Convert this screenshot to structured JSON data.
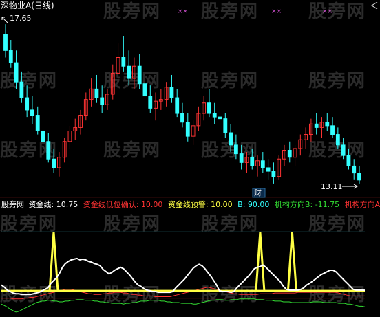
{
  "main_panel": {
    "title": "深物业A(日线)",
    "high_label": "17.65",
    "low_label": "13.11",
    "marker_label": "财"
  },
  "indicator_panel": {
    "brand": "股旁网",
    "items": [
      {
        "label": "资金线:",
        "value": "10.75",
        "color": "#ffffff"
      },
      {
        "label": "资金线低位确认:",
        "value": "10.00",
        "color": "#ff3333"
      },
      {
        "label": "资金线预警:",
        "value": "10.00",
        "color": "#ffff44"
      },
      {
        "label": "B:",
        "value": "90.00",
        "color": "#33ffff"
      },
      {
        "label": "机构方向B:",
        "value": "-11.75",
        "color": "#33dd33"
      },
      {
        "label": "机构方向A:",
        "value": "",
        "color": "#ff3333"
      }
    ]
  },
  "watermark": "股旁网",
  "colors": {
    "up": "#ff3333",
    "down": "#33ffff",
    "line_cyan": "#40c0d0",
    "line_yellow": "#ffff44",
    "line_red": "#ff3333",
    "line_green": "#33dd33",
    "line_white": "#ffffff"
  },
  "chart_data": [
    {
      "type": "candlestick",
      "title": "深物业A(日线)",
      "annotations": [
        "17.65",
        "13.11",
        "财"
      ],
      "ohlc": [
        [
          17.35,
          17.65,
          16.7,
          16.9
        ],
        [
          16.9,
          17.2,
          16.4,
          16.55
        ],
        [
          16.55,
          16.9,
          15.8,
          16.0
        ],
        [
          16.0,
          16.3,
          15.4,
          15.55
        ],
        [
          15.55,
          15.9,
          15.0,
          15.2
        ],
        [
          15.2,
          15.6,
          14.8,
          15.05
        ],
        [
          15.05,
          15.3,
          14.5,
          14.6
        ],
        [
          14.6,
          15.0,
          14.1,
          14.3
        ],
        [
          14.3,
          14.55,
          13.7,
          13.8
        ],
        [
          13.8,
          14.1,
          13.4,
          13.55
        ],
        [
          13.55,
          14.0,
          13.3,
          13.85
        ],
        [
          13.85,
          14.4,
          13.7,
          14.3
        ],
        [
          14.3,
          14.75,
          14.1,
          14.6
        ],
        [
          14.6,
          14.95,
          14.35,
          14.7
        ],
        [
          14.7,
          15.2,
          14.5,
          15.05
        ],
        [
          15.05,
          15.7,
          14.9,
          15.5
        ],
        [
          15.5,
          16.1,
          15.3,
          15.8
        ],
        [
          15.8,
          16.2,
          15.4,
          15.55
        ],
        [
          15.55,
          15.9,
          15.1,
          15.35
        ],
        [
          15.35,
          15.8,
          15.2,
          15.65
        ],
        [
          15.65,
          16.5,
          15.5,
          16.25
        ],
        [
          16.25,
          17.1,
          16.0,
          16.7
        ],
        [
          16.7,
          17.3,
          16.3,
          16.45
        ],
        [
          16.45,
          16.9,
          15.9,
          16.1
        ],
        [
          16.1,
          16.7,
          15.8,
          16.45
        ],
        [
          16.45,
          16.8,
          15.8,
          15.95
        ],
        [
          15.95,
          16.3,
          15.4,
          15.6
        ],
        [
          15.6,
          15.9,
          15.1,
          15.25
        ],
        [
          15.25,
          15.7,
          14.9,
          15.45
        ],
        [
          15.45,
          15.8,
          15.2,
          15.5
        ],
        [
          15.5,
          16.0,
          15.3,
          15.85
        ],
        [
          15.85,
          16.2,
          15.4,
          15.55
        ],
        [
          15.55,
          15.8,
          15.0,
          15.1
        ],
        [
          15.1,
          15.4,
          14.7,
          14.85
        ],
        [
          14.85,
          15.1,
          14.3,
          14.45
        ],
        [
          14.45,
          14.9,
          14.2,
          14.75
        ],
        [
          14.75,
          15.3,
          14.6,
          15.1
        ],
        [
          15.1,
          15.6,
          14.9,
          15.4
        ],
        [
          15.4,
          15.8,
          15.0,
          15.1
        ],
        [
          15.1,
          15.4,
          14.8,
          15.0
        ],
        [
          15.0,
          15.3,
          14.7,
          14.95
        ],
        [
          14.95,
          15.1,
          14.4,
          14.55
        ],
        [
          14.55,
          14.8,
          14.0,
          14.2
        ],
        [
          14.2,
          14.5,
          13.8,
          13.95
        ],
        [
          13.95,
          14.2,
          13.5,
          13.7
        ],
        [
          13.7,
          14.0,
          13.4,
          13.85
        ],
        [
          13.85,
          14.1,
          13.5,
          13.6
        ],
        [
          13.6,
          13.9,
          13.3,
          13.75
        ],
        [
          13.75,
          14.0,
          13.4,
          13.55
        ],
        [
          13.55,
          13.8,
          13.2,
          13.45
        ],
        [
          13.45,
          13.7,
          13.1,
          13.3
        ],
        [
          13.3,
          13.9,
          13.2,
          13.8
        ],
        [
          13.8,
          14.2,
          13.6,
          14.05
        ],
        [
          14.05,
          14.3,
          13.7,
          13.85
        ],
        [
          13.85,
          14.2,
          13.6,
          14.1
        ],
        [
          14.1,
          14.5,
          13.9,
          14.35
        ],
        [
          14.35,
          14.7,
          14.1,
          14.5
        ],
        [
          14.5,
          14.95,
          14.3,
          14.8
        ],
        [
          14.8,
          15.1,
          14.5,
          14.7
        ],
        [
          14.7,
          15.0,
          14.4,
          14.85
        ],
        [
          14.85,
          15.1,
          14.6,
          14.75
        ],
        [
          14.75,
          15.0,
          14.4,
          14.5
        ],
        [
          14.5,
          14.7,
          14.1,
          14.2
        ],
        [
          14.2,
          14.4,
          13.8,
          13.9
        ],
        [
          13.9,
          14.1,
          13.5,
          13.6
        ],
        [
          13.6,
          13.8,
          13.2,
          13.4
        ],
        [
          13.4,
          13.6,
          13.1,
          13.2
        ]
      ]
    },
    {
      "type": "line",
      "title": "股旁网",
      "ylim": [
        -20,
        110
      ],
      "series": [
        {
          "name": "资金线",
          "values": [
            18,
            15,
            11,
            9,
            7,
            6,
            6,
            5,
            5,
            5,
            5,
            6,
            7,
            8,
            10,
            12,
            14,
            20,
            24,
            28,
            34,
            42,
            47,
            50,
            52,
            53,
            54,
            52,
            53,
            52,
            50,
            49,
            47,
            46,
            44,
            39,
            36,
            33,
            35,
            38,
            40,
            42,
            40,
            36,
            32,
            27,
            22,
            18,
            16,
            13,
            11,
            10,
            9,
            9,
            8,
            8,
            8,
            8,
            8,
            9,
            14,
            18,
            22,
            26,
            31,
            36,
            41,
            44,
            46,
            44,
            40,
            35,
            30,
            24,
            18,
            10,
            9,
            9,
            9,
            8,
            9,
            14,
            18,
            22,
            26,
            30,
            35,
            40,
            42,
            43,
            45,
            42,
            38,
            34,
            30,
            26,
            22,
            16,
            12,
            11,
            11,
            11,
            11,
            12,
            14,
            18,
            20,
            23,
            26,
            29,
            32,
            34,
            36,
            38,
            38,
            36,
            32,
            28,
            24,
            20,
            16,
            12,
            11,
            11,
            11,
            10.75
          ]
        },
        {
          "name": "资金线预警",
          "values": [
            10,
            10,
            10,
            10,
            10,
            10,
            10,
            10,
            10,
            10,
            10,
            10,
            10,
            10,
            10,
            10,
            10,
            10,
            10,
            10,
            10,
            10,
            10,
            10,
            10,
            10,
            10,
            10,
            10,
            10,
            10,
            10,
            10,
            10,
            10,
            10,
            10,
            10,
            10,
            10,
            10,
            10,
            10,
            10,
            10,
            10,
            10,
            10,
            10,
            10,
            10,
            10,
            10,
            10,
            10,
            10,
            10,
            10,
            10,
            10,
            10,
            10,
            10,
            10,
            10,
            10,
            10,
            10,
            10,
            10,
            10,
            10,
            10,
            10,
            10,
            10,
            10,
            10,
            10,
            10,
            10,
            10,
            10,
            10,
            10,
            10,
            10,
            10,
            10,
            10,
            10,
            10,
            10,
            10,
            10,
            10,
            10,
            10,
            10,
            10,
            10,
            10,
            10,
            10,
            10,
            10,
            10,
            10,
            10,
            10,
            10,
            10,
            10,
            10,
            10,
            10,
            10,
            10,
            10,
            10,
            10,
            10,
            10,
            10,
            10,
            10
          ]
        },
        {
          "name": "B",
          "values": [
            90,
            90,
            90,
            90,
            90,
            90,
            90,
            90,
            90,
            90,
            90,
            90,
            90,
            90,
            90,
            90,
            90,
            90,
            90,
            90,
            90,
            90,
            90,
            90,
            90,
            90,
            90,
            90,
            90,
            90,
            90,
            90,
            90,
            90,
            90,
            90,
            90,
            90,
            90,
            90,
            90,
            90,
            90,
            90,
            90,
            90,
            90,
            90,
            90,
            90,
            90,
            90,
            90,
            90,
            90,
            90,
            90,
            90,
            90,
            90,
            90,
            90,
            90,
            90,
            90,
            90,
            90,
            90,
            90,
            90,
            90,
            90,
            90,
            90,
            90,
            90,
            90,
            90,
            90,
            90,
            90,
            90,
            90,
            90,
            90,
            90,
            90,
            90,
            90,
            90,
            90,
            90,
            90,
            90,
            90,
            90,
            90,
            90,
            90,
            90,
            90,
            90,
            90,
            90,
            90,
            90,
            90,
            90,
            90,
            90,
            90,
            90,
            90,
            90,
            90,
            90,
            90,
            90,
            90,
            90,
            90,
            90,
            90,
            90,
            90,
            90
          ]
        },
        {
          "name": "机构方向B",
          "values": [
            -8,
            -10,
            -12,
            -15,
            -17,
            -19,
            -18,
            -16,
            -14,
            -12,
            -10,
            -8,
            -6,
            -5,
            -4,
            -4,
            -3,
            -3,
            -4,
            -4,
            -5,
            -5,
            -4,
            -4,
            -3,
            -3,
            -2,
            -2,
            -2,
            -3,
            -3,
            -3,
            -4,
            -4,
            -5,
            -5,
            -6,
            -6,
            -7,
            -7,
            -7,
            -7,
            -8,
            -7,
            -7,
            -6,
            -6,
            -5,
            -4,
            -4,
            -4,
            -3,
            -3,
            -3,
            -3,
            -4,
            -4,
            -5,
            -5,
            -6,
            -6,
            -6,
            -7,
            -7,
            -7,
            -7,
            -8,
            -8,
            -7,
            -6,
            -5,
            -4,
            -3,
            -3,
            -2,
            -2,
            -2,
            -3,
            -3,
            -2,
            -2,
            -2,
            -1,
            -1,
            -1,
            -1,
            -1,
            -1,
            -2,
            -2,
            -2,
            -3,
            -3,
            -3,
            -4,
            -4,
            -4,
            -5,
            -5,
            -5,
            -6,
            -6,
            -6,
            -6,
            -6,
            -6,
            -6,
            -5,
            -5,
            -5,
            -5,
            -6,
            -6,
            -6,
            -6,
            -6,
            -7,
            -7,
            -7,
            -8,
            -8,
            -9,
            -10,
            -11,
            -11,
            -11.75
          ]
        },
        {
          "name": "机构方向A",
          "values": [
            0,
            0,
            0,
            0,
            -1,
            -1,
            -1,
            -1,
            0,
            0,
            1,
            1,
            2,
            3,
            4,
            5,
            6,
            7,
            8,
            9,
            10,
            11,
            12,
            12,
            12,
            11,
            10,
            9,
            8,
            7,
            6,
            6,
            5,
            5,
            5,
            6,
            6,
            7,
            7,
            8,
            8,
            8,
            7,
            7,
            6,
            5,
            5,
            4,
            4,
            3,
            3,
            3,
            3,
            2,
            2,
            2,
            2,
            2,
            2,
            3,
            4,
            5,
            6,
            7,
            8,
            9,
            10,
            11,
            12,
            13,
            14,
            15,
            14,
            13,
            12,
            11,
            10,
            9,
            8,
            7,
            6,
            6,
            5,
            5,
            5,
            5,
            5,
            5,
            5,
            6,
            6,
            6,
            6,
            6,
            7,
            7,
            7,
            7,
            7,
            7,
            7,
            7,
            8,
            8,
            8,
            8,
            8,
            8,
            8,
            8,
            8,
            8,
            8,
            8,
            8,
            8,
            7,
            6,
            5,
            4,
            3,
            3,
            3,
            3,
            3,
            3
          ]
        },
        {
          "name": "资金线低位确认",
          "values": [
            0,
            0,
            0,
            0,
            0,
            0,
            0,
            0,
            0,
            0,
            0,
            0,
            0,
            0,
            0,
            0,
            0,
            0,
            90,
            0,
            0,
            0,
            0,
            0,
            0,
            0,
            0,
            0,
            0,
            0,
            0,
            0,
            0,
            0,
            0,
            0,
            0,
            0,
            0,
            0,
            0,
            0,
            0,
            0,
            0,
            0,
            0,
            0,
            0,
            0,
            0,
            0,
            0,
            0,
            0,
            0,
            0,
            0,
            0,
            0,
            0,
            0,
            0,
            0,
            0,
            0,
            0,
            0,
            0,
            0,
            0,
            0,
            0,
            0,
            0,
            0,
            0,
            0,
            0,
            0,
            0,
            0,
            0,
            0,
            0,
            0,
            0,
            0,
            0,
            90,
            0,
            0,
            0,
            0,
            0,
            0,
            0,
            0,
            0,
            0,
            90,
            0,
            0,
            0,
            0,
            0,
            0,
            0,
            0,
            0,
            0,
            0,
            0,
            0,
            0,
            0,
            0,
            0,
            0,
            0,
            0,
            0,
            0,
            0,
            0,
            0
          ]
        }
      ]
    }
  ]
}
